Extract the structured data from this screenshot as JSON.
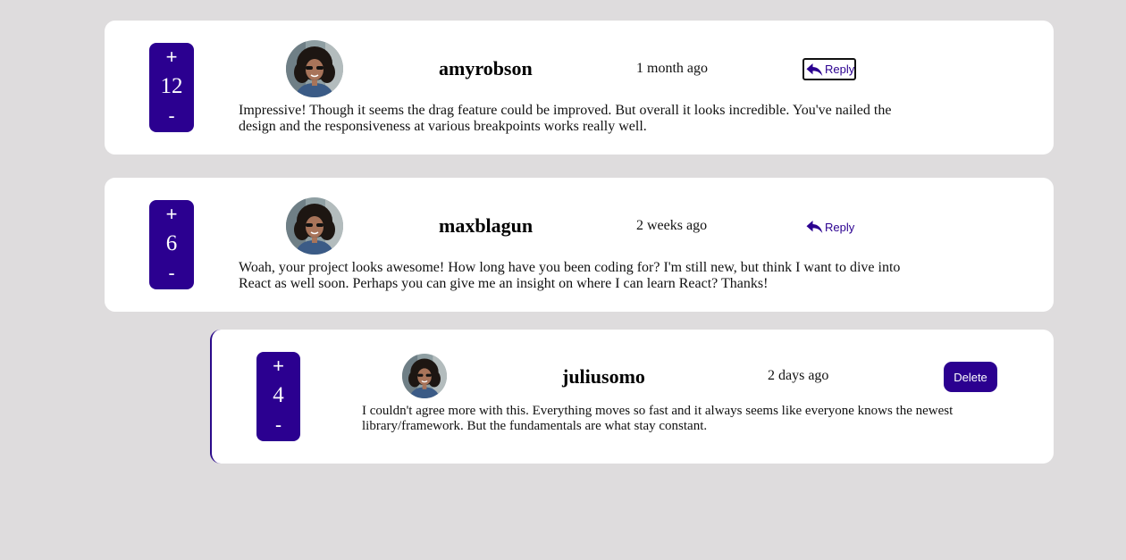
{
  "comments": [
    {
      "score": "12",
      "upvote": "+",
      "downvote": "-",
      "username": "amyrobson",
      "time": "1 month ago",
      "action": "Reply",
      "content": "Impressive! Though it seems the drag feature could be improved. But overall it looks incredible. You've nailed the design and the responsiveness at various breakpoints works really well."
    },
    {
      "score": "6",
      "upvote": "+",
      "downvote": "-",
      "username": "maxblagun",
      "time": "2 weeks ago",
      "action": "Reply",
      "content": "Woah, your project looks awesome! How long have you been coding for? I'm still new, but think I want to dive into React as well soon. Perhaps you can give me an insight on where I can learn React? Thanks!"
    },
    {
      "score": "4",
      "upvote": "+",
      "downvote": "-",
      "username": "juliusomo",
      "time": "2 days ago",
      "action": "Delete",
      "content": "I couldn't agree more with this. Everything moves so fast and it always seems like everyone knows the newest library/framework. But the fundamentals are what stay constant."
    }
  ],
  "icons": {
    "reply": "reply-arrow-icon",
    "avatar": "avatar-photo"
  },
  "colors": {
    "accent": "#2b0090",
    "background": "#dedcdd",
    "card": "#ffffff"
  }
}
